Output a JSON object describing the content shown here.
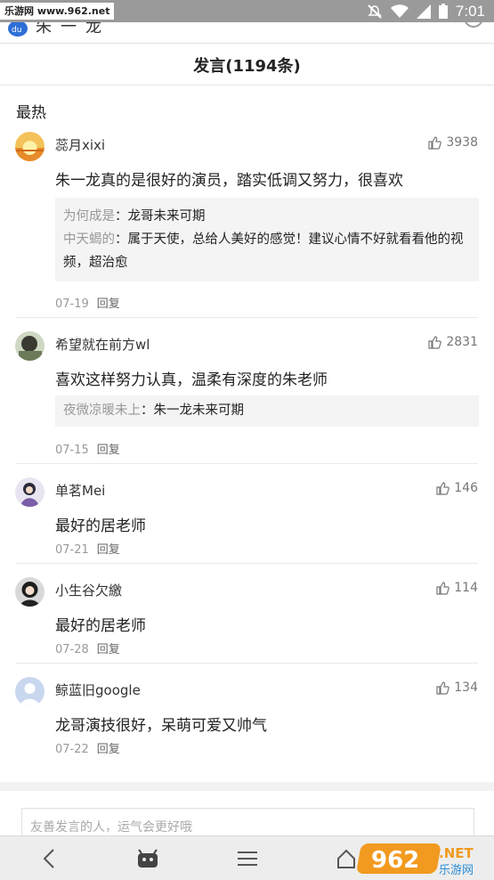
{
  "status_bar": {
    "watermark": "乐游网 www.962.net",
    "time": "7:01"
  },
  "app_bar": {
    "title_fragment": "朱一龙"
  },
  "header": {
    "title": "发言(1194条)"
  },
  "section_title": "最热",
  "reply_label": "回复",
  "comments": [
    {
      "user": "蕊月xixi",
      "likes": "3938",
      "text": "朱一龙真的是很好的演员，踏实低调又努力，很喜欢",
      "replies": [
        {
          "author": "为何成是",
          "text": "：龙哥未来可期"
        },
        {
          "author": "中天蝎的",
          "text": "：属于天使，总给人美好的感觉！建议心情不好就看看他的视频，超治愈"
        }
      ],
      "date": "07-19"
    },
    {
      "user": "希望就在前方wl",
      "likes": "2831",
      "text": "喜欢这样努力认真，温柔有深度的朱老师",
      "replies": [
        {
          "author": "夜微凉暖未上",
          "text": "：朱一龙未来可期"
        }
      ],
      "date": "07-15"
    },
    {
      "user": "单茗Mei",
      "likes": "146",
      "text": "最好的居老师",
      "date": "07-21"
    },
    {
      "user": "小生谷欠繳",
      "likes": "114",
      "text": "最好的居老师",
      "date": "07-28"
    },
    {
      "user": "鲸蓝旧google",
      "likes": "134",
      "text": "龙哥演技很好，呆萌可爱又帅气",
      "date": "07-22"
    }
  ],
  "input": {
    "placeholder": "友善发言的人，运气会更好哦"
  },
  "colors": {
    "status_bar": "#9a9a9a",
    "divider": "#e9e9e9",
    "reply_bg": "#f4f4f4",
    "muted_text": "#999999",
    "watermark_orange": "#f29a1f"
  }
}
